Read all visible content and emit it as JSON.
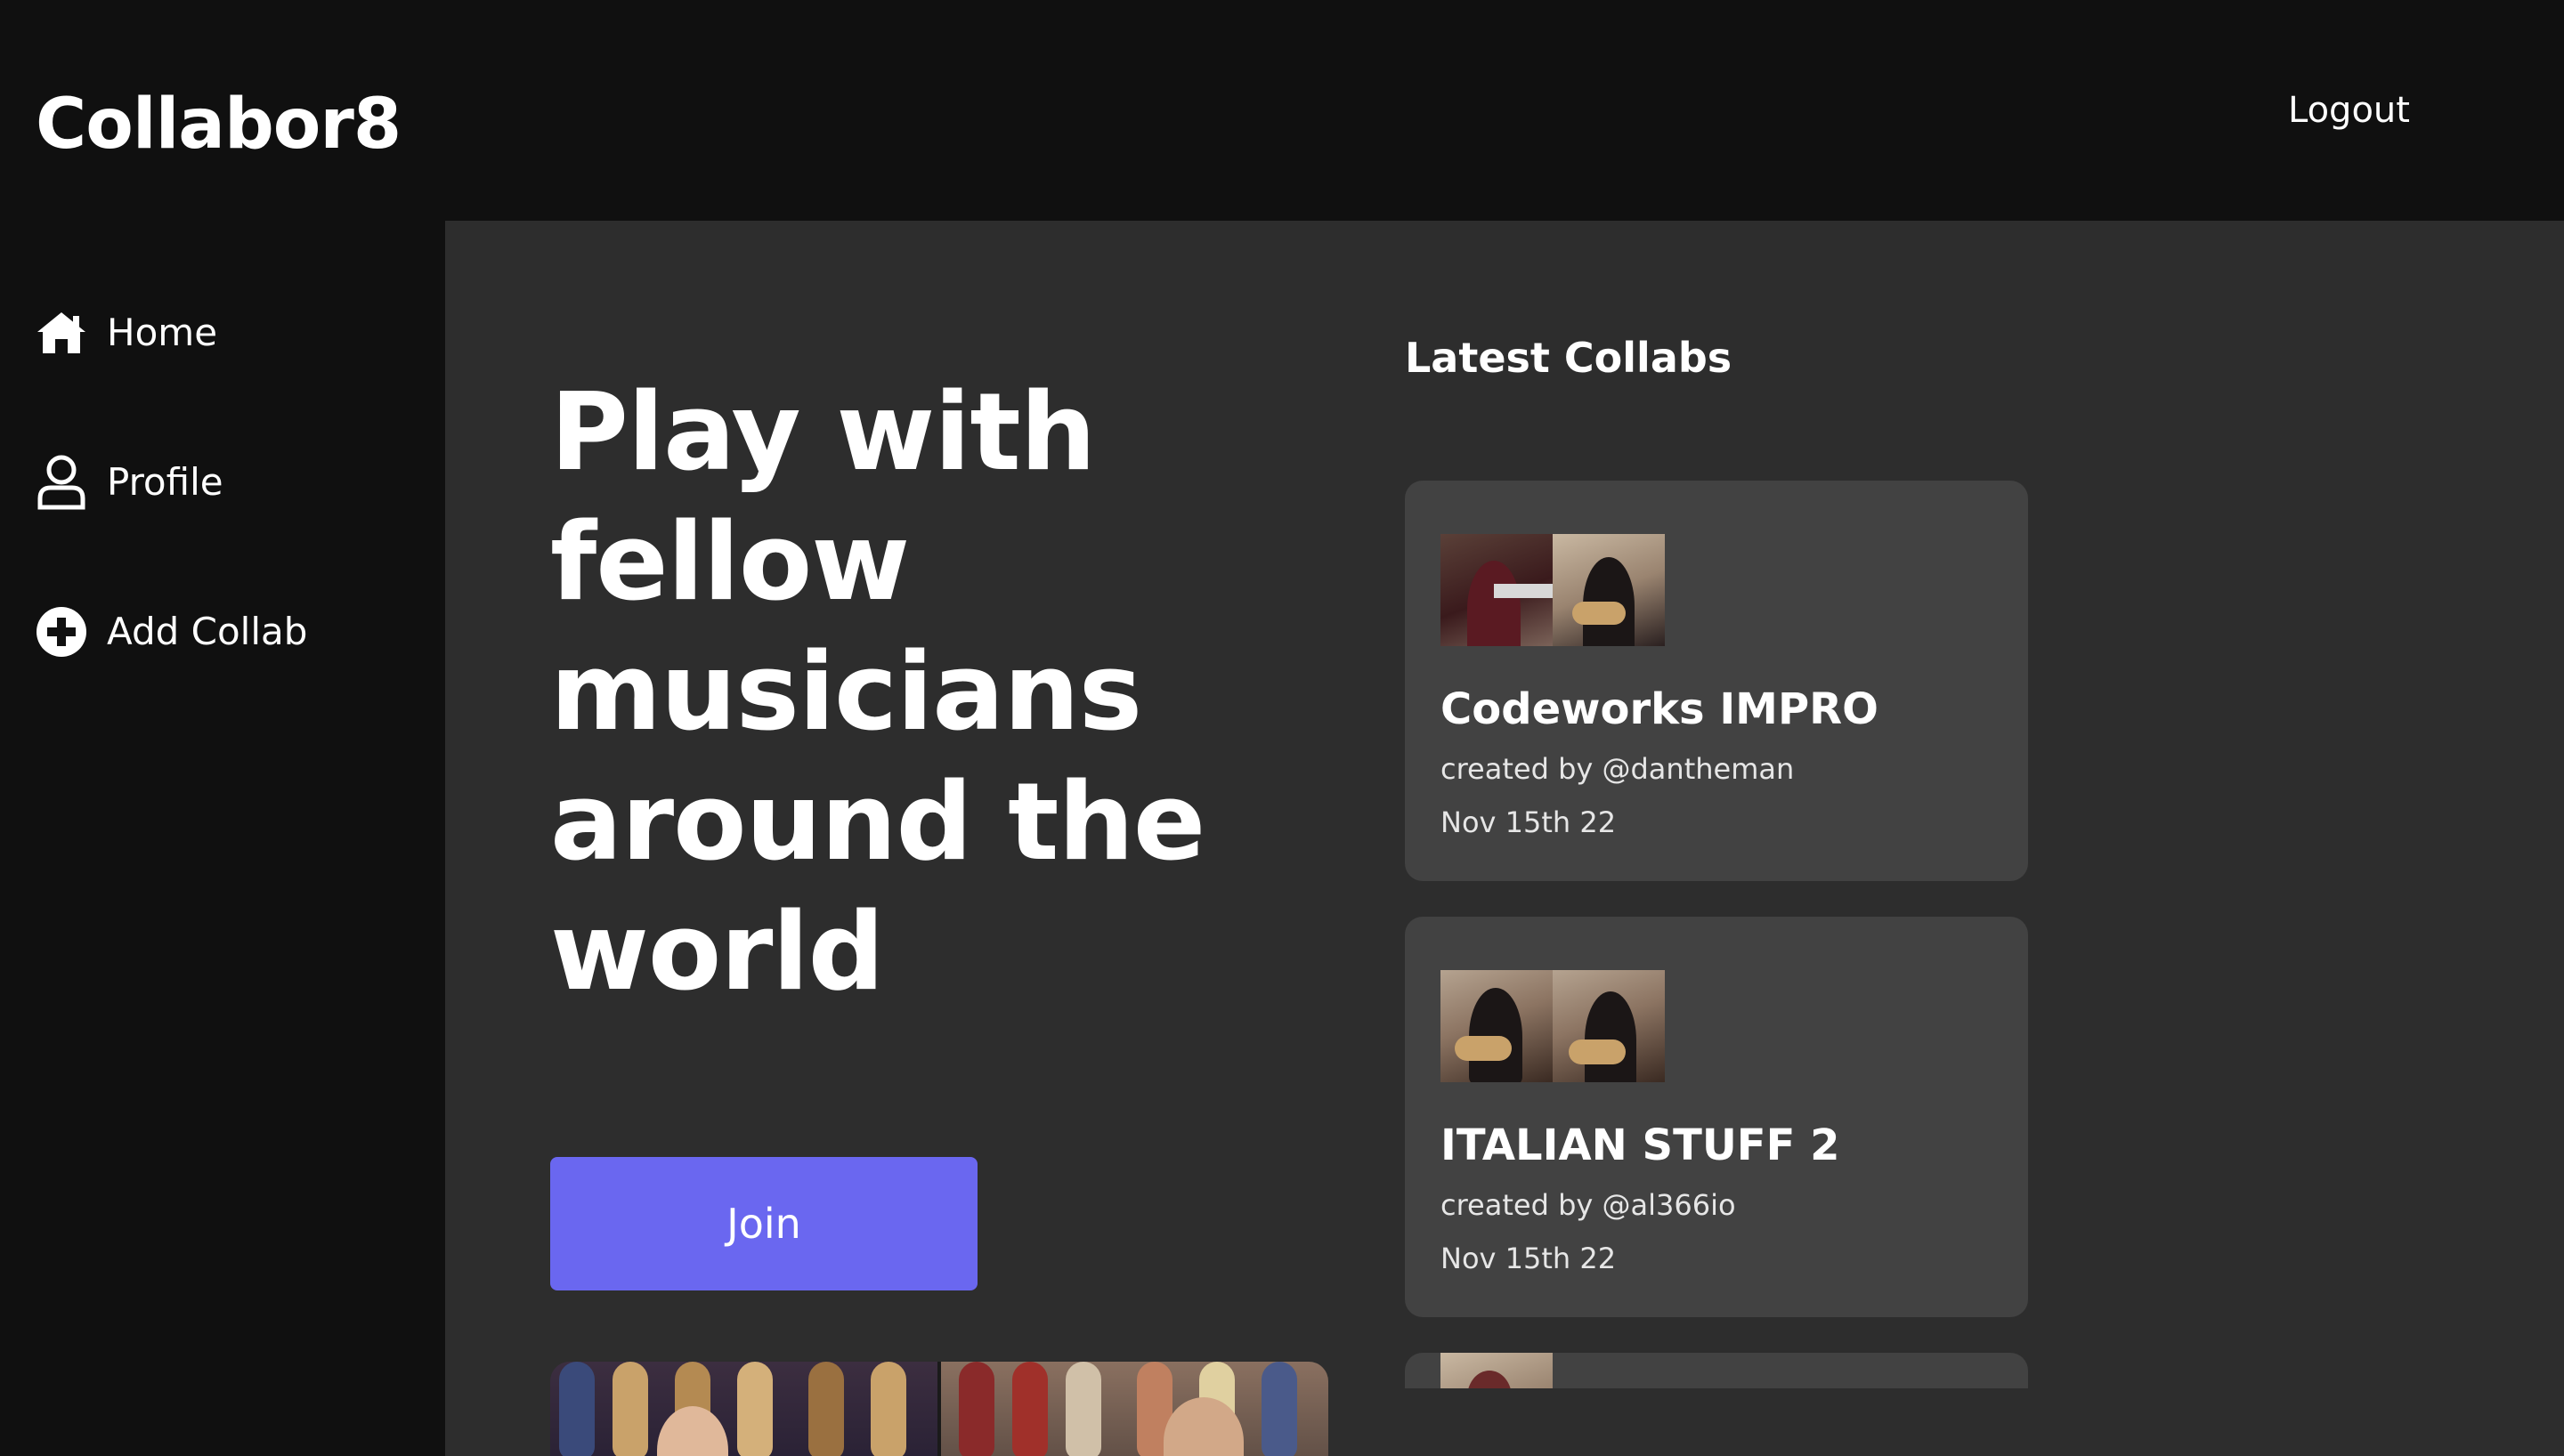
{
  "header": {
    "brand": "Collabor8",
    "logout_label": "Logout"
  },
  "sidebar": {
    "items": [
      {
        "label": "Home",
        "icon": "home-icon"
      },
      {
        "label": "Profile",
        "icon": "user-icon"
      },
      {
        "label": "Add Collab",
        "icon": "plus-circle-icon"
      }
    ]
  },
  "hero": {
    "title": "Play with fellow musicians around the world",
    "join_label": "Join"
  },
  "latest": {
    "title": "Latest Collabs",
    "collabs": [
      {
        "title": "Codeworks IMPRO",
        "author": "created by @dantheman",
        "date": "Nov 15th 22"
      },
      {
        "title": "ITALIAN STUFF 2",
        "author": "created by @al366io",
        "date": "Nov 15th 22"
      }
    ]
  },
  "colors": {
    "background": "#101010",
    "panel": "#2d2d2d",
    "card": "#424242",
    "accent": "#6a67f0",
    "text": "#ffffff"
  }
}
